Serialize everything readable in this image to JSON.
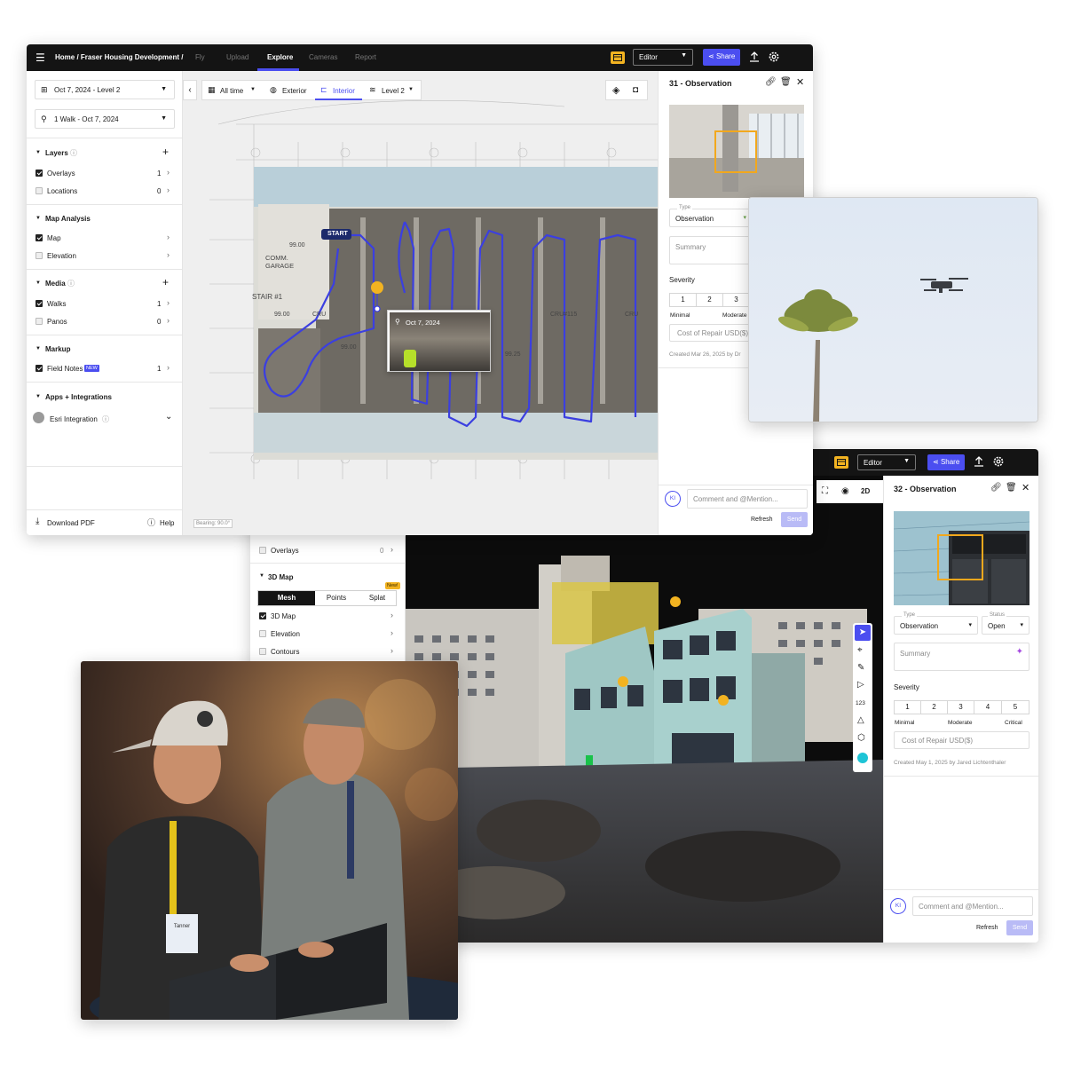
{
  "win1": {
    "breadcrumb": "Home / Fraser Housing Development /",
    "tabs": [
      "Fly",
      "Upload",
      "Explore",
      "Cameras",
      "Report"
    ],
    "active_tab": "Explore",
    "editor_select": "Editor",
    "share": "Share",
    "date_select": "Oct 7, 2024 - Level 2",
    "walk_select": "1 Walk - Oct 7, 2024",
    "sections": {
      "layers": "Layers",
      "map_analysis": "Map Analysis",
      "media": "Media",
      "markup": "Markup",
      "apps": "Apps + Integrations"
    },
    "rows": {
      "overlays": {
        "label": "Overlays",
        "count": "1"
      },
      "locations": {
        "label": "Locations",
        "count": "0"
      },
      "map": {
        "label": "Map"
      },
      "elevation": {
        "label": "Elevation"
      },
      "walks": {
        "label": "Walks",
        "count": "1"
      },
      "panos": {
        "label": "Panos",
        "count": "0"
      },
      "field_notes": {
        "label": "Field Notes",
        "badge": "NEW",
        "count": "1"
      }
    },
    "esri": "Esri Integration",
    "download": "Download PDF",
    "help": "Help",
    "toolbar": {
      "time": "All time",
      "exterior": "Exterior",
      "interior": "Interior",
      "level": "Level 2"
    },
    "map": {
      "start": "START",
      "pano_date": "Oct 7, 2024",
      "labels": {
        "comm_garage": "COMM.\nGARAGE",
        "stair": "STAIR #1",
        "elev1": "99.00",
        "elev2": "99.00",
        "elev3": "99.00",
        "elev4": "99.25",
        "cru1": "CRU",
        "cru2": "CRU#115",
        "cru3": "CRU"
      },
      "bearing": "Bearing: 90.0°"
    },
    "obs": {
      "title": "31 - Observation",
      "type_label": "Type",
      "type_value": "Observation",
      "summary": "Summary",
      "severity": "Severity",
      "sev_values": [
        "1",
        "2",
        "3"
      ],
      "sev_min": "Minimal",
      "sev_mid": "Moderate",
      "cost": "Cost of Repair USD($)",
      "created": "Created Mar 26, 2025 by Dr",
      "avatar": "KI",
      "comment_placeholder": "Comment and @Mention...",
      "refresh": "Refresh",
      "send": "Send"
    }
  },
  "win2": {
    "editor_select": "Editor",
    "share": "Share",
    "overlays": {
      "label": "Overlays",
      "count": "0"
    },
    "section_3d": "3D Map",
    "seg": [
      "Mesh",
      "Points",
      "Splat"
    ],
    "seg_badge": "New!",
    "rows": {
      "map3d": "3D Map",
      "elevation": "Elevation",
      "contours": "Contours"
    },
    "view_2d": "2D",
    "tool_123": "123",
    "obs": {
      "title": "32 - Observation",
      "type_label": "Type",
      "type_value": "Observation",
      "status_label": "Status",
      "status_value": "Open",
      "summary": "Summary",
      "severity": "Severity",
      "sev_values": [
        "1",
        "2",
        "3",
        "4",
        "5"
      ],
      "sev_min": "Minimal",
      "sev_mid": "Moderate",
      "sev_max": "Critical",
      "cost": "Cost of Repair USD($)",
      "created": "Created May 1, 2025 by Jared Lichtenthaler",
      "avatar": "KI",
      "comment_placeholder": "Comment and @Mention...",
      "refresh": "Refresh",
      "send": "Send"
    }
  },
  "photo_people": {
    "badge_text": "Tanner"
  },
  "colors": {
    "accent": "#4b4ef0",
    "path": "#3b3fe0",
    "marker": "#f2b321",
    "topbar": "#141414",
    "cyan": "#1ec4d6"
  }
}
